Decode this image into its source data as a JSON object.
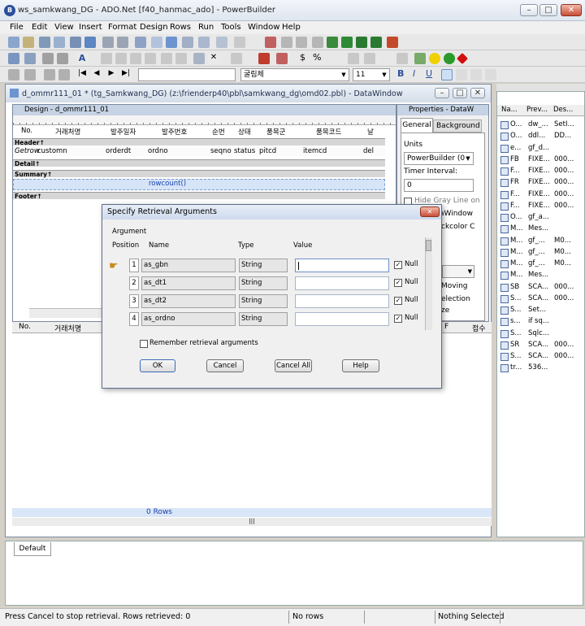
{
  "app": {
    "title": "ws_samkwang_DG - ADO.Net [f40_hanmac_ado] - PowerBuilder",
    "logo": "B"
  },
  "menu": [
    "File",
    "Edit",
    "View",
    "Insert",
    "Format",
    "Design",
    "Rows",
    "Run",
    "Tools",
    "Window",
    "Help"
  ],
  "toolbar": {
    "font_name": "굴림체",
    "font_size": "11",
    "bold": "B",
    "italic": "I",
    "underline": "U",
    "currency": "$",
    "percent": "%"
  },
  "datawindow": {
    "title": "d_ommr111_01 * (tg_Samkwang_DG) (z:\\frienderp40\\pbl\\samkwang_dg\\omd02.pbl) - DataWindow",
    "design_title": "Design - d_ommr111_01",
    "header_cols": [
      "No.",
      "거래처명",
      "발주일자",
      "발주번호",
      "순번",
      "상태",
      "품목군",
      "품목코드",
      "날"
    ],
    "bands": {
      "header": "Header↑",
      "detail": "Detail↑",
      "summary": "Summary↑",
      "footer": "Footer↑"
    },
    "detail_cols": [
      "Getrow",
      "customn",
      "orderdt",
      "ordno",
      "seqno",
      "status",
      "pitcd",
      "itemcd",
      "del"
    ],
    "summary_expr": "rowcount()",
    "preview_cols": {
      "no": "No.",
      "name": "거래처명",
      "last1": "F",
      "last2": "접수"
    },
    "row_count": "0 Rows",
    "hscroll": "|||"
  },
  "properties": {
    "title": "Properties - DataW",
    "tabs": [
      "General",
      "Background"
    ],
    "units_label": "Units",
    "units_value": "PowerBuilder (0",
    "timer_label": "Timer Interval:",
    "timer_value": "0",
    "hide_gray": "Hide Gray Line on",
    "partial1": "aWindow",
    "partial2": "ckcolor C",
    "partial3": "Moving",
    "partial4": "election",
    "partial5": "ze"
  },
  "right_panel": {
    "headers": [
      "Na...",
      "Prev...",
      "Des..."
    ],
    "rows": [
      [
        "O...",
        "dw_...",
        "SetI..."
      ],
      [
        "O...",
        "ddl...",
        "DD..."
      ],
      [
        "e...",
        "gf_d...",
        ""
      ],
      [
        "FB",
        "FIXE...",
        "000..."
      ],
      [
        "F...",
        "FIXE...",
        "000..."
      ],
      [
        "FR",
        "FIXE...",
        "000..."
      ],
      [
        "F...",
        "FIXE...",
        "000..."
      ],
      [
        "F...",
        "FIXE...",
        "000..."
      ],
      [
        "O...",
        "gf_a...",
        ""
      ],
      [
        "M...",
        "Mes...",
        ""
      ],
      [
        "M...",
        "gf_...",
        "M0..."
      ],
      [
        "M...",
        "gf_...",
        "M0..."
      ],
      [
        "M...",
        "gf_...",
        "M0..."
      ],
      [
        "M...",
        "Mes...",
        ""
      ],
      [
        "SB",
        "SCA...",
        "000..."
      ],
      [
        "S...",
        "SCA...",
        "000..."
      ],
      [
        "S...",
        "Set...",
        ""
      ],
      [
        "s...",
        "if sq...",
        ""
      ],
      [
        "S...",
        "Sqlc...",
        ""
      ],
      [
        "SR",
        "SCA...",
        "000..."
      ],
      [
        "S...",
        "SCA...",
        "000..."
      ],
      [
        "tr...",
        "536...",
        ""
      ]
    ]
  },
  "dialog": {
    "title": "Specify Retrieval Arguments",
    "group_label": "Argument",
    "headers": {
      "position": "Position",
      "name": "Name",
      "type": "Type",
      "value": "Value"
    },
    "args": [
      {
        "pos": "1",
        "name": "as_gbn",
        "type": "String",
        "value": "",
        "null": "Null"
      },
      {
        "pos": "2",
        "name": "as_dt1",
        "type": "String",
        "value": "",
        "null": "Null"
      },
      {
        "pos": "3",
        "name": "as_dt2",
        "type": "String",
        "value": "",
        "null": "Null"
      },
      {
        "pos": "4",
        "name": "as_ordno",
        "type": "String",
        "value": "",
        "null": "Null"
      }
    ],
    "remember": "Remember retrieval arguments",
    "ok": "OK",
    "cancel": "Cancel",
    "cancel_all": "Cancel All",
    "help": "Help"
  },
  "bottom_panel": {
    "tab": "Default"
  },
  "status": {
    "message": "Press Cancel to stop retrieval. Rows retrieved: 0",
    "rows": "No rows",
    "selection": "Nothing Selected"
  }
}
